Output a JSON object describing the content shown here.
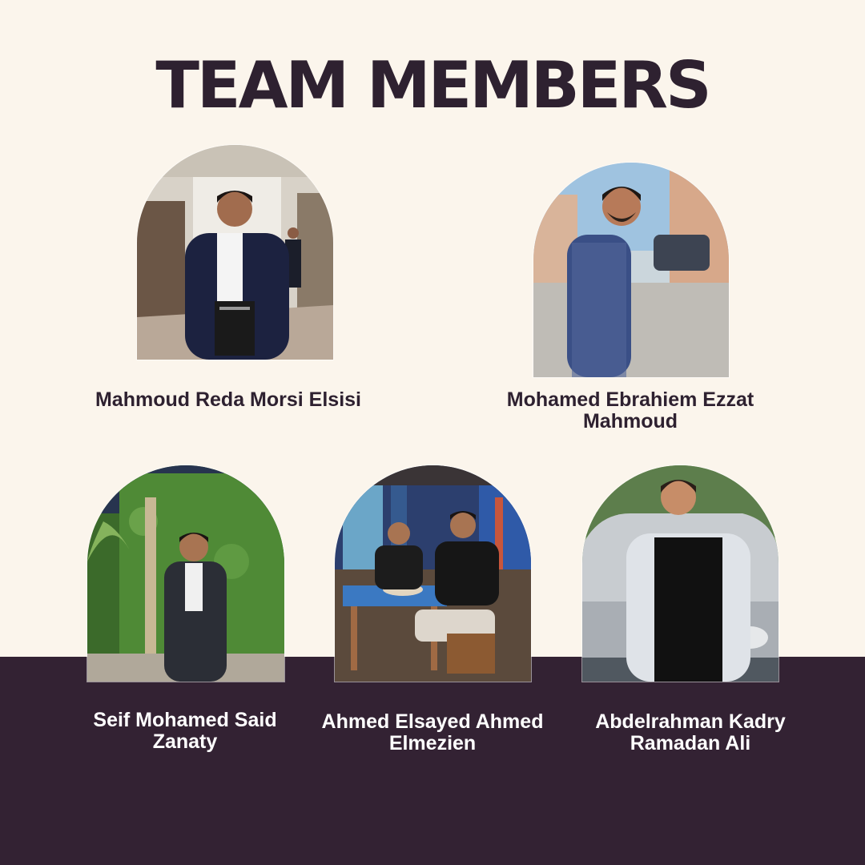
{
  "title": "TEAM MEMBERS",
  "colors": {
    "background": "#fbf5ec",
    "band": "#332233",
    "heading": "#2e2130"
  },
  "members": [
    {
      "name": "Mahmoud Reda Morsi Elsisi"
    },
    {
      "name": "Mohamed Ebrahiem Ezzat Mahmoud"
    },
    {
      "name": "Seif Mohamed Said Zanaty"
    },
    {
      "name": "Ahmed Elsayed Ahmed Elmezien"
    },
    {
      "name": "Abdelrahman Kadry Ramadan Ali"
    }
  ]
}
